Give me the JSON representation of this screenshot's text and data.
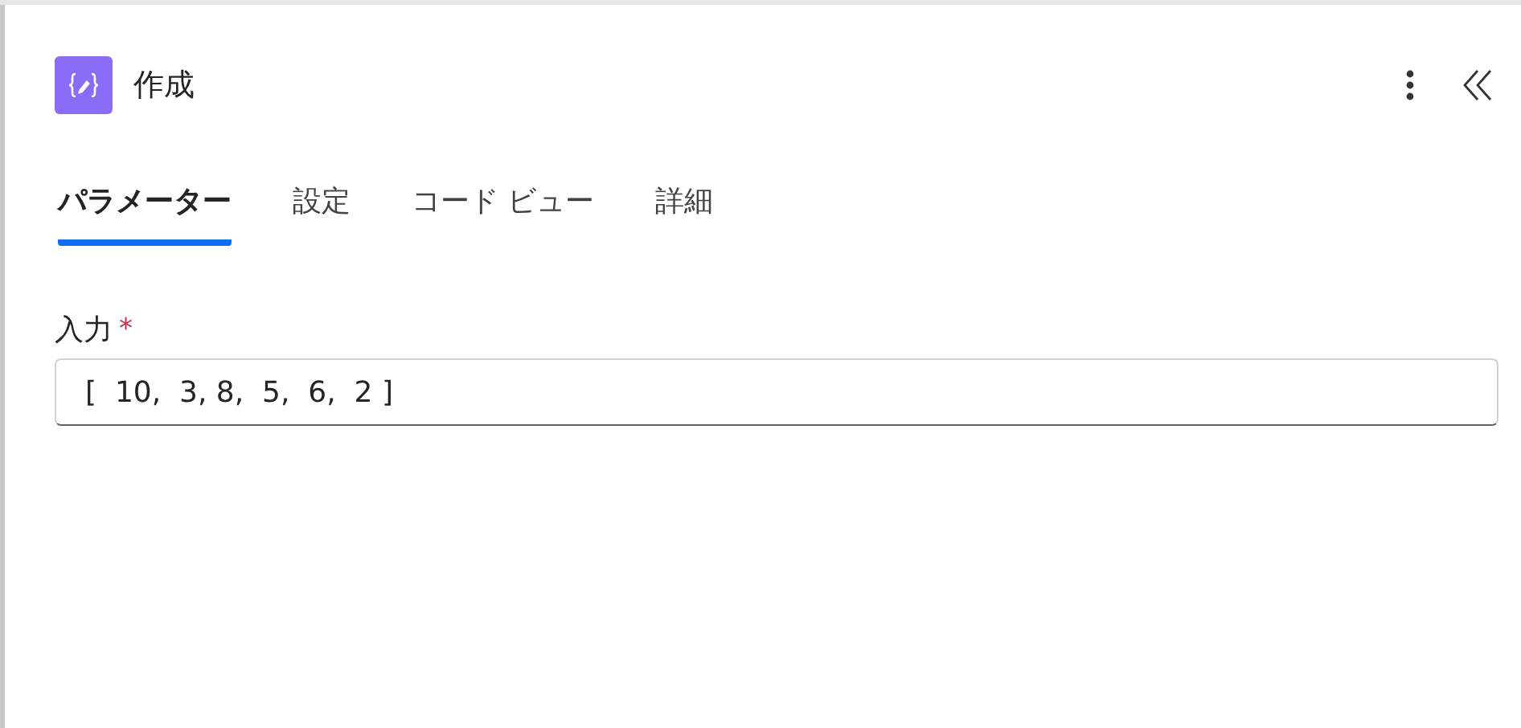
{
  "header": {
    "title": "作成"
  },
  "tabs": [
    {
      "label": "パラメーター",
      "selected": true
    },
    {
      "label": "設定",
      "selected": false
    },
    {
      "label": "コード ビュー",
      "selected": false
    },
    {
      "label": "詳細",
      "selected": false
    }
  ],
  "field": {
    "label": "入力",
    "required_mark": "*",
    "value": "[  10,  3, 8,  5,  6,  2 ]"
  }
}
